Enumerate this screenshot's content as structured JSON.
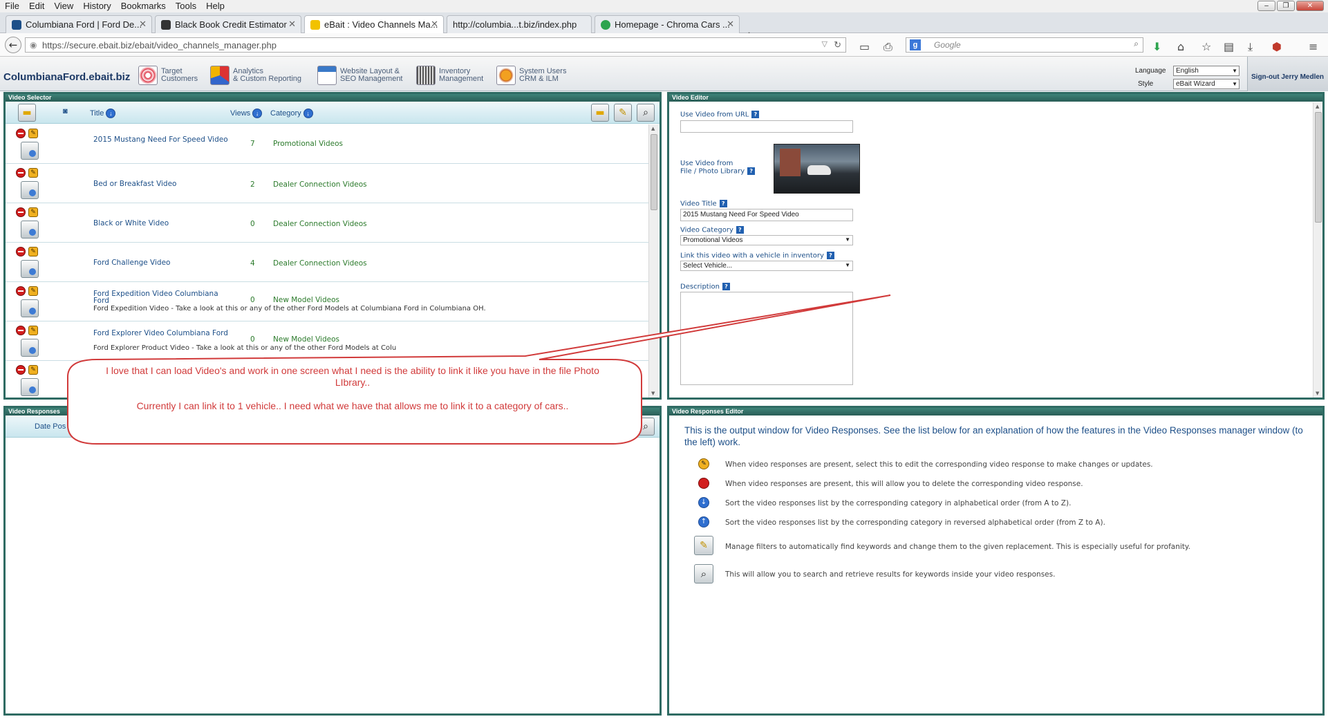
{
  "browser": {
    "menu": [
      "File",
      "Edit",
      "View",
      "History",
      "Bookmarks",
      "Tools",
      "Help"
    ],
    "tabs": [
      {
        "label": "Columbiana Ford | Ford De...",
        "active": false
      },
      {
        "label": "Black Book Credit Estimator",
        "active": false
      },
      {
        "label": "eBait : Video Channels Ma...",
        "active": true
      },
      {
        "label": "http://columbia...t.biz/index.php",
        "active": false
      },
      {
        "label": "Homepage - Chroma Cars ...",
        "active": false
      }
    ],
    "url": "https://secure.ebait.biz/ebait/video_channels_manager.php",
    "search_placeholder": "Google"
  },
  "app": {
    "brand": "ColumbianaFord.ebait.biz",
    "nav": [
      {
        "line1": "Target",
        "line2": "Customers"
      },
      {
        "line1": "Analytics",
        "line2": "& Custom Reporting"
      },
      {
        "line1": "Website Layout &",
        "line2": "SEO Management"
      },
      {
        "line1": "Inventory",
        "line2": "Management"
      },
      {
        "line1": "System Users",
        "line2": "CRM & ILM"
      }
    ],
    "language_label": "Language",
    "language_value": "English",
    "style_label": "Style",
    "style_value": "eBait Wizard",
    "signout": "Sign-out Jerry Medlen"
  },
  "video_selector": {
    "title": "Video Selector",
    "col_title": "Title",
    "col_views": "Views",
    "col_category": "Category",
    "rows": [
      {
        "title": "2015 Mustang Need For Speed Video",
        "views": "7",
        "category": "Promotional Videos",
        "desc": ""
      },
      {
        "title": "Bed or Breakfast Video",
        "views": "2",
        "category": "Dealer Connection Videos",
        "desc": ""
      },
      {
        "title": "Black or White Video",
        "views": "0",
        "category": "Dealer Connection Videos",
        "desc": ""
      },
      {
        "title": "Ford Challenge Video",
        "views": "4",
        "category": "Dealer Connection Videos",
        "desc": ""
      },
      {
        "title": "Ford Expedition Video Columbiana Ford",
        "views": "0",
        "category": "New Model Videos",
        "desc": "Ford Expedition Video - Take a look at this or any of the other Ford Models at Columbiana Ford in Columbiana OH."
      },
      {
        "title": "Ford Explorer Video Columbiana Ford",
        "views": "0",
        "category": "New Model Videos",
        "desc": "Ford Explorer Product Video - Take a look at this or any of the other Ford Models at Colu"
      },
      {
        "title": "",
        "views": "",
        "category": "",
        "desc": ""
      }
    ]
  },
  "video_responses": {
    "title": "Video Responses",
    "col_date": "Date Pos"
  },
  "video_editor": {
    "title": "Video Editor",
    "url_label": "Use Video from URL",
    "url_value": "",
    "file_label_1": "Use Video from",
    "file_label_2": "File / Photo Library",
    "video_title_label": "Video Title",
    "video_title_value": "2015 Mustang Need For Speed Video",
    "category_label": "Video Category",
    "category_value": "Promotional Videos",
    "link_label": "Link this video with a vehicle in inventory",
    "link_value": "Select Vehicle...",
    "description_label": "Description"
  },
  "responses_editor": {
    "title": "Video Responses Editor",
    "intro": "This is the output window for Video Responses. See the list below for an explanation of how the features in the Video Responses manager window (to the left) work.",
    "items": [
      "When video responses are present, select this to edit the corresponding video response to make changes or updates.",
      "When video responses are present, this will allow you to delete the corresponding video response.",
      "Sort the video responses list by the corresponding category in alphabetical order (from A to Z).",
      "Sort the video responses list by the corresponding category in reversed alphabetical order (from Z to A).",
      "Manage filters to automatically find keywords and change them to the given replacement. This is especially useful for profanity.",
      "This will allow you to search and retrieve results for keywords inside your video responses."
    ]
  },
  "callout": {
    "line1": "I love that I can load Video's and work in one screen what I need is the ability to link it like you have in the file Photo LIbrary..",
    "line2": "Currently I can link it to 1 vehicle.. I need what we have that allows me to link it to a category of cars.."
  }
}
